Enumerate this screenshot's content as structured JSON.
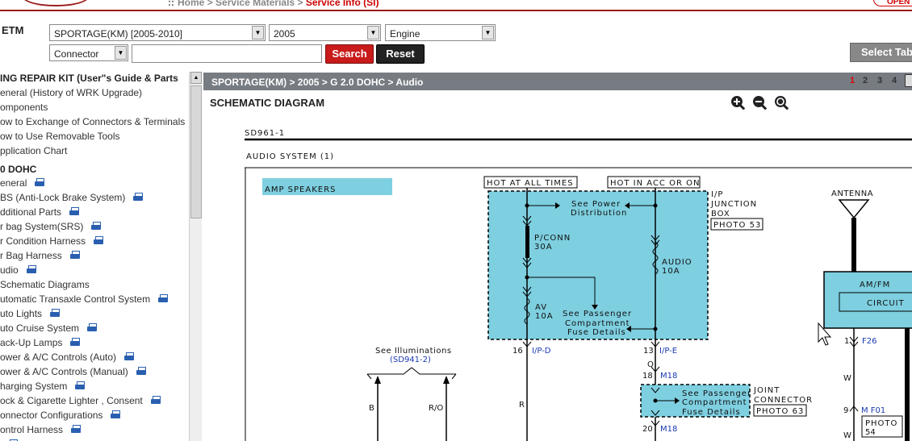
{
  "breadcrumb": {
    "home": "Home",
    "sep": ">",
    "service_materials": "Service Materials",
    "current": "Service Info (SI)"
  },
  "header": {
    "open_label": "OPEN",
    "etm_label": "ETM"
  },
  "filters": {
    "model": "SPORTAGE(KM) [2005-2010]",
    "year": "2005",
    "engine": "Engine",
    "type": "Connector",
    "search_value": "",
    "search_label": "Search",
    "reset_label": "Reset",
    "select_tab_label": "Select Tab"
  },
  "sidebar": {
    "items": [
      {
        "label": "ING REPAIR KIT (User\"s Guide & Parts",
        "bold": true,
        "printer": false
      },
      {
        "label": "eneral (History of WRK Upgrade)",
        "bold": false,
        "printer": false
      },
      {
        "label": "omponents",
        "bold": false,
        "printer": false
      },
      {
        "label": "ow to Exchange of Connectors & Terminals",
        "bold": false,
        "printer": false
      },
      {
        "label": "ow to Use Removable Tools",
        "bold": false,
        "printer": false
      },
      {
        "label": "pplication Chart",
        "bold": false,
        "printer": false
      },
      {
        "label": "0 DOHC",
        "bold": true,
        "printer": false
      },
      {
        "label": "eneral",
        "bold": false,
        "printer": true
      },
      {
        "label": "BS (Anti-Lock Brake System)",
        "bold": false,
        "printer": true
      },
      {
        "label": "dditional Parts",
        "bold": false,
        "printer": true
      },
      {
        "label": "r bag System(SRS)",
        "bold": false,
        "printer": true
      },
      {
        "label": "r Condition Harness",
        "bold": false,
        "printer": true
      },
      {
        "label": "r Bag Harness",
        "bold": false,
        "printer": true
      },
      {
        "label": "udio",
        "bold": false,
        "printer": true
      },
      {
        "label": " Schematic Diagrams",
        "bold": false,
        "printer": false
      },
      {
        "label": "utomatic Transaxle Control System",
        "bold": false,
        "printer": true
      },
      {
        "label": "uto Lights",
        "bold": false,
        "printer": true
      },
      {
        "label": "uto Cruise System",
        "bold": false,
        "printer": true
      },
      {
        "label": "ack-Up Lamps",
        "bold": false,
        "printer": true
      },
      {
        "label": "ower & A/C Controls (Auto)",
        "bold": false,
        "printer": true
      },
      {
        "label": "ower & A/C Controls (Manual)",
        "bold": false,
        "printer": true
      },
      {
        "label": "harging System",
        "bold": false,
        "printer": true
      },
      {
        "label": "ock & Cigarette Lighter , Consent",
        "bold": false,
        "printer": true
      },
      {
        "label": "onnector Configurations",
        "bold": false,
        "printer": true
      },
      {
        "label": "ontrol Harness",
        "bold": false,
        "printer": true
      },
      {
        "label": "",
        "bold": false,
        "printer": true
      }
    ]
  },
  "main": {
    "path": "SPORTAGE(KM) > 2005 > G 2.0 DOHC > Audio",
    "pages": [
      "1",
      "2",
      "3",
      "4"
    ],
    "active_page": "1",
    "title": "SCHEMATIC DIAGRAM"
  },
  "diagram": {
    "code": "SD961-1",
    "system": "AUDIO SYSTEM (1)",
    "amp_speakers": "AMP SPEAKERS",
    "hot_at_all_times": "HOT AT ALL TIMES",
    "hot_in_acc_or_on": "HOT IN ACC OR ON",
    "see_power_1": "See Power",
    "see_power_2": "Distribution",
    "ip_junction_1": "I/P",
    "ip_junction_2": "JUNCTION",
    "ip_junction_3": "BOX",
    "photo_53": "PHOTO 53",
    "pconn_1": "P/CONN",
    "pconn_2": "30A",
    "audio_fuse_1": "AUDIO",
    "audio_fuse_2": "10A",
    "av_fuse_1": "AV",
    "av_fuse_2": "10A",
    "see_pass_1": "See Passenger",
    "see_pass_2": "Compartment",
    "see_pass_3": "Fuse Details",
    "antenna": "ANTENNA",
    "amfm": "AM/FM",
    "circuit": "CIRCUIT",
    "f26": "F26",
    "pin_1": "1",
    "see_illum": "See Illuminations",
    "sd941": "(SD941-2)",
    "pin_16": "16",
    "ip_d": "I/P-D",
    "pin_13": "13",
    "ip_e": "I/P-E",
    "wire_o": "O",
    "pin_18": "18",
    "m18_a": "M18",
    "joint_1": "JOINT",
    "joint_2": "CONNECTOR",
    "photo_63": "PHOTO 63",
    "wire_b": "B",
    "wire_ro": "R/O",
    "wire_r": "R",
    "wire_w": "W",
    "pin_9": "9",
    "mf01": "M F01",
    "photo_54_1": "PHOTO",
    "photo_54_2": "54",
    "pin_20": "20",
    "m18_b": "M18",
    "wire_w2": "W"
  },
  "colors": {
    "brand_red": "#c91b1b",
    "box_fill": "#7ecfe0",
    "pathbar": "#777b82",
    "link_blue": "#1a3ab0"
  }
}
